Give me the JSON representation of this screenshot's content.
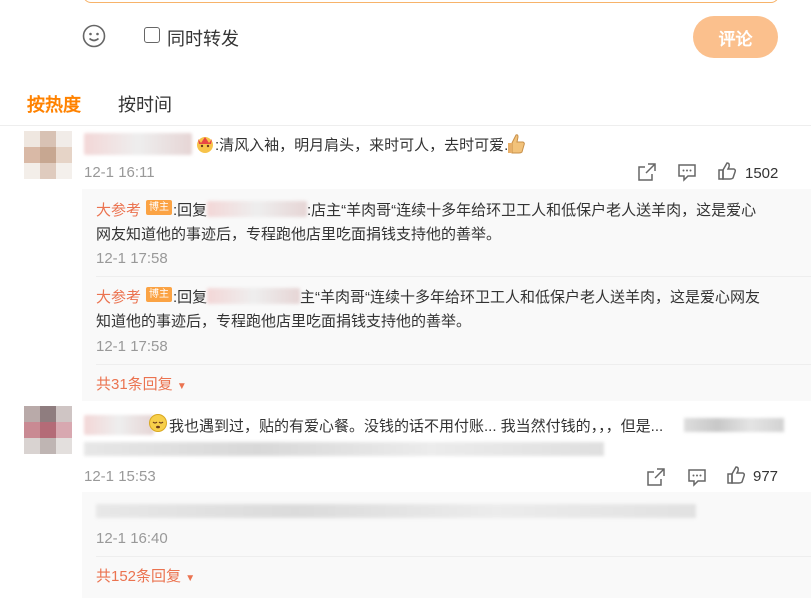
{
  "compose": {
    "repost_label": "同时转发",
    "submit_label": "评论"
  },
  "sort_tabs": {
    "hot": "按热度",
    "time": "按时间"
  },
  "comments": [
    {
      "text": ":清风入袖，明月肩头，来时可人，去时可爱.",
      "time": "12-1 16:11",
      "likes": "1502",
      "replies": [
        {
          "author": "大参考",
          "badge": "博主",
          "prefix": ":回复",
          "text1": ":店主“羊肉哥“连续十多年给环卫工人和低保户老人送羊肉，这是爱心",
          "text2": "网友知道他的事迹后，专程跑他店里吃面捐钱支持他的善举。",
          "time": "12-1 17:58"
        },
        {
          "author": "大参考",
          "badge": "博主",
          "prefix": ":回复",
          "text1": "主“羊肉哥“连续十多年给环卫工人和低保户老人送羊肉，这是爱心网友",
          "text2": "知道他的事迹后，专程跑他店里吃面捐钱支持他的善举。",
          "time": "12-1 17:58"
        }
      ],
      "more_replies": "共31条回复"
    },
    {
      "text": "我也遇到过，贴的有爱心餐。没钱的话不用付账... 我当然付钱的，，，但是...",
      "time": "12-1 15:53",
      "likes": "977",
      "replies": [
        {
          "time": "12-1 16:40"
        }
      ],
      "more_replies": "共152条回复"
    }
  ]
}
